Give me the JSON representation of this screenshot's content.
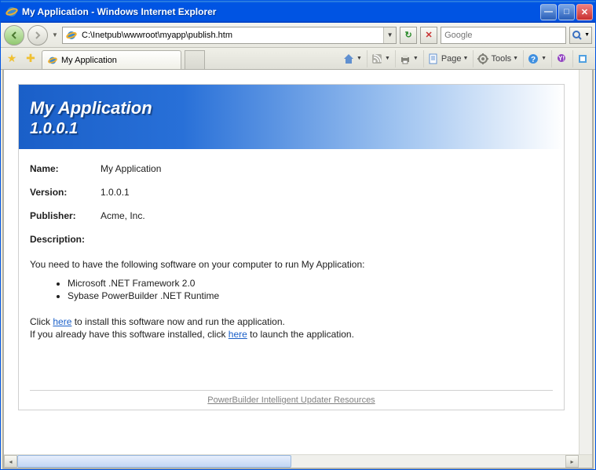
{
  "window": {
    "title": "My Application - Windows Internet Explorer"
  },
  "nav": {
    "address": "C:\\Inetpub\\wwwroot\\myapp\\publish.htm",
    "search_placeholder": "Google",
    "refresh_glyph": "↻",
    "stop_glyph": "✕"
  },
  "tabs": {
    "active": "My Application"
  },
  "toolstrip": {
    "page": "Page",
    "tools": "Tools"
  },
  "page": {
    "banner_title": "My Application",
    "banner_version": "1.0.0.1",
    "labels": {
      "name": "Name:",
      "version": "Version:",
      "publisher": "Publisher:",
      "description": "Description:"
    },
    "name": "My Application",
    "version": "1.0.0.1",
    "publisher": "Acme, Inc.",
    "requirements_intro": "You need to have the following software on your computer to run My Application:",
    "requirements": [
      "Microsoft .NET Framework 2.0",
      "Sybase PowerBuilder .NET Runtime"
    ],
    "install": {
      "pre1": "Click ",
      "link1": "here",
      "post1": " to install this software now and run the application.",
      "pre2": "If you already have this software installed, click ",
      "link2": "here",
      "post2": " to launch the application."
    },
    "footer_link": "PowerBuilder Intelligent Updater Resources"
  }
}
